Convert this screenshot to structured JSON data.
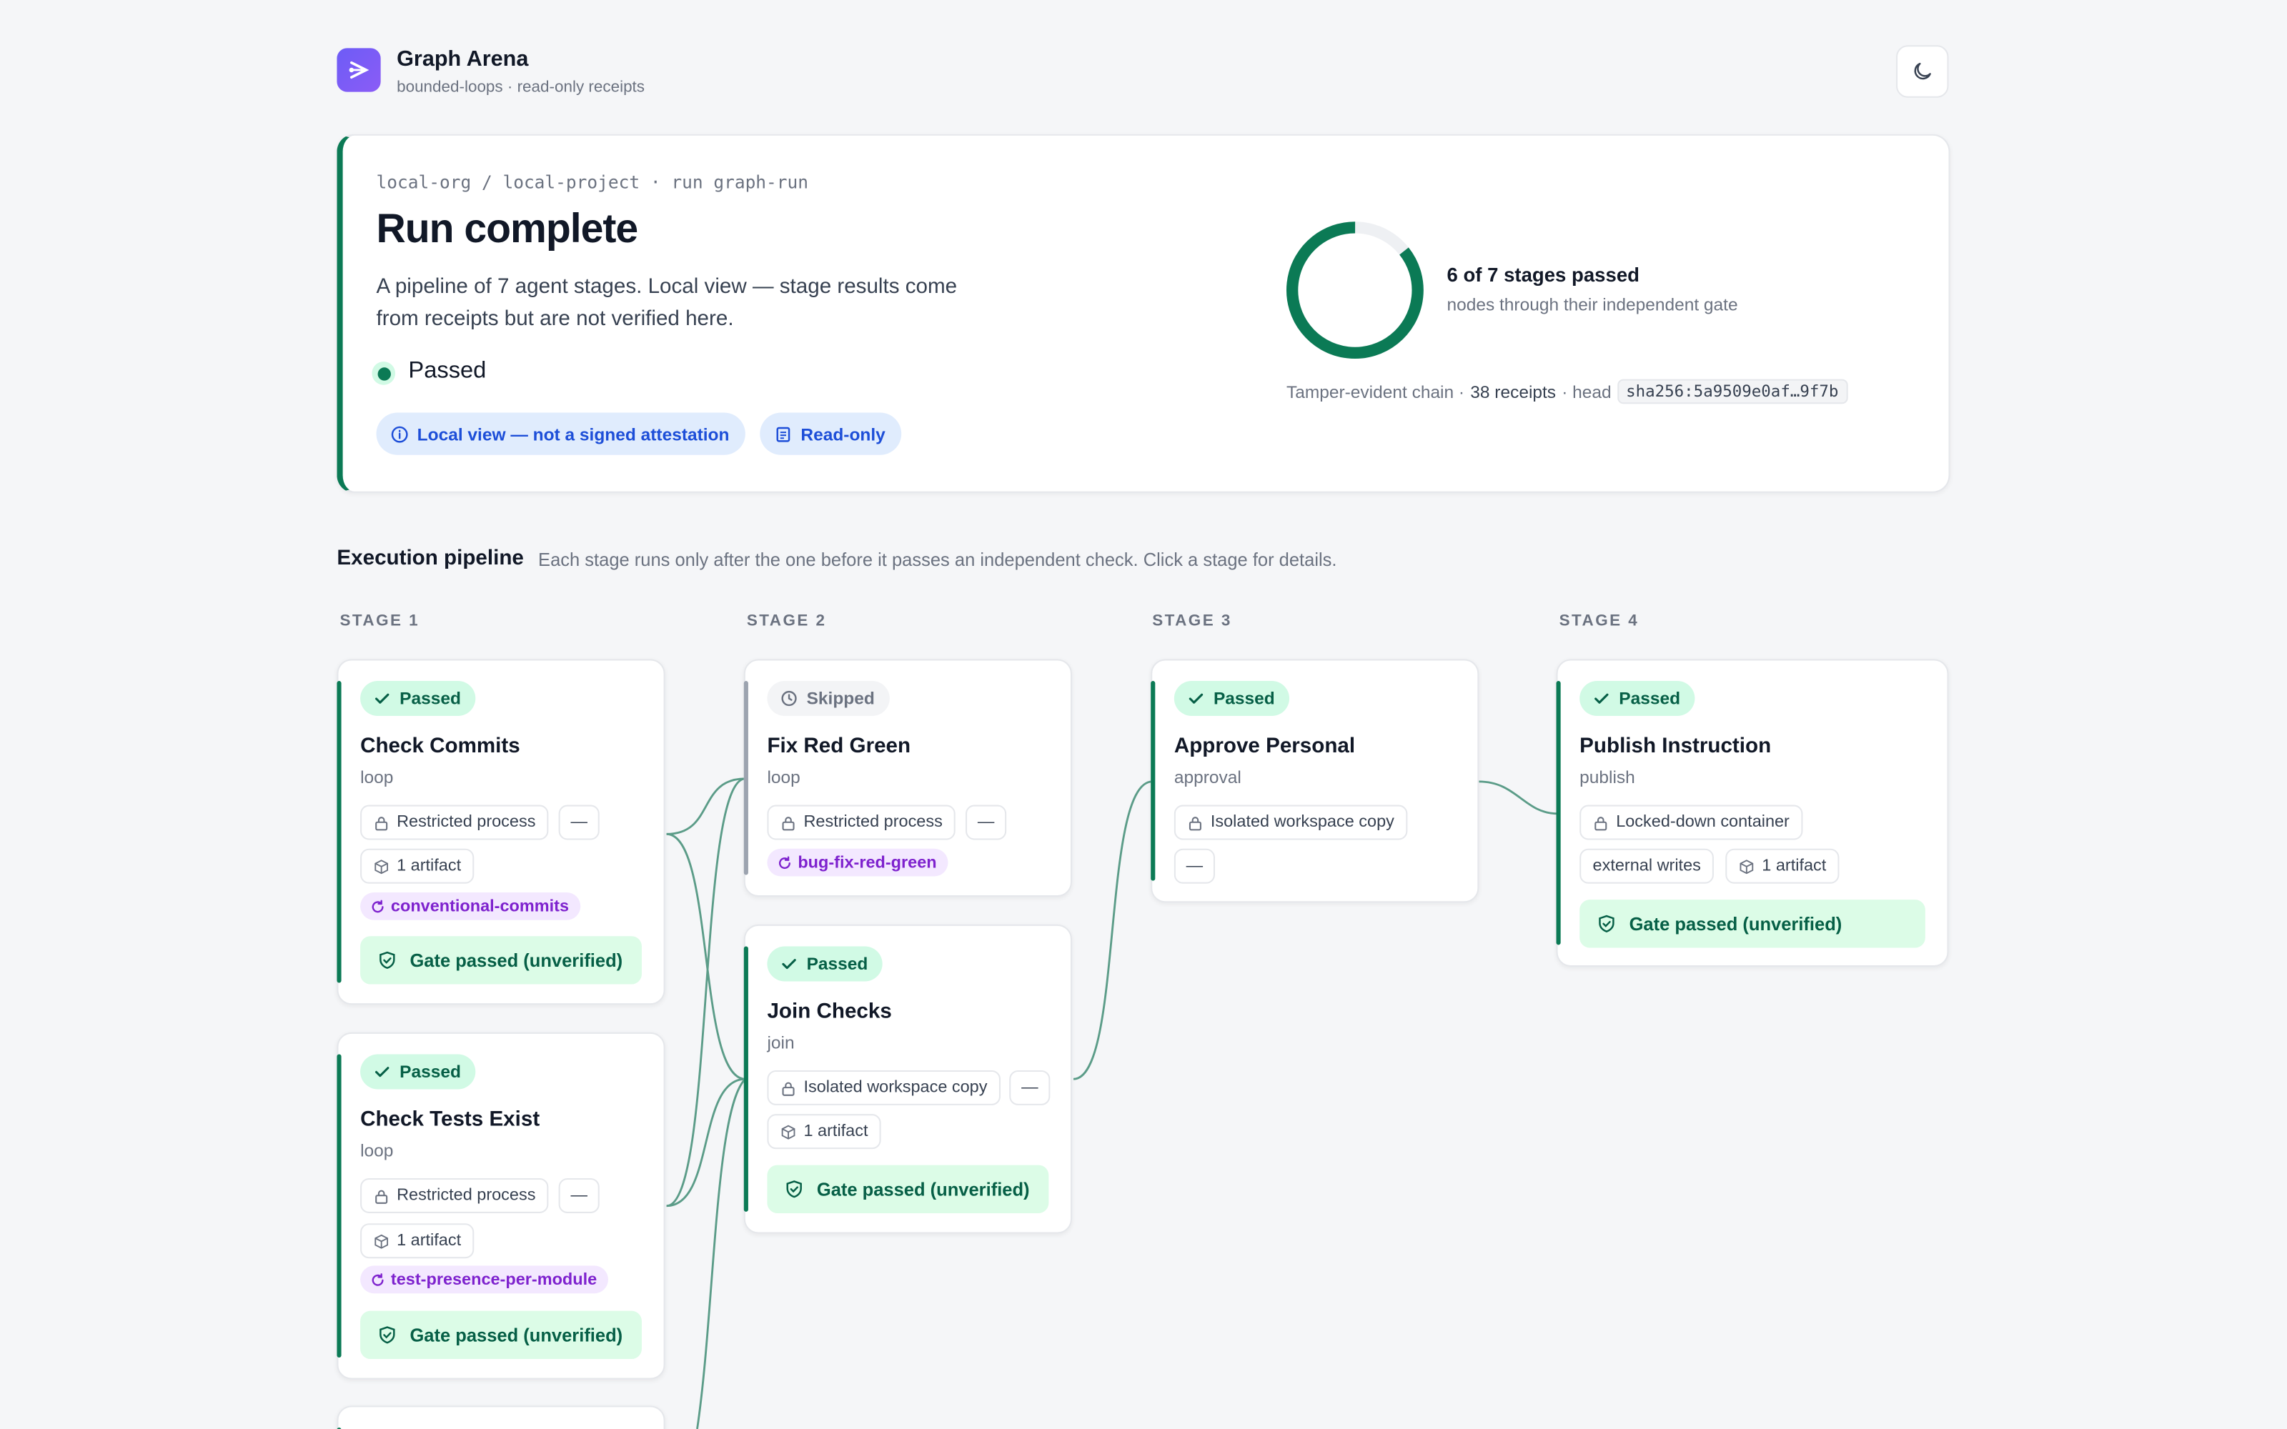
{
  "app": {
    "title": "Graph Arena",
    "subtitle": "bounded-loops · read-only receipts",
    "theme_icon": "moon-icon"
  },
  "summary": {
    "breadcrumb": "local-org / local-project · run graph-run",
    "title": "Run complete",
    "description": "A pipeline of 7 agent stages. Local view — stage results come from receipts but are not verified here.",
    "status": "Passed",
    "pills": [
      "Local view — not a signed attestation",
      "Read-only"
    ],
    "progress": {
      "passed": 6,
      "total": 7,
      "label": "6 of 7 stages passed",
      "sublabel": "nodes through their independent gate"
    },
    "chain": {
      "prefix": "Tamper-evident chain ·",
      "receipts": "38 receipts",
      "sep": "· head",
      "hash": "sha256:5a9509e0af…9f7b"
    }
  },
  "pipeline": {
    "title": "Execution pipeline",
    "description": "Each stage runs only after the one before it passes an independent check. Click a stage for details.",
    "stages": [
      "STAGE 1",
      "STAGE 2",
      "STAGE 3",
      "STAGE 4"
    ],
    "nodes": [
      {
        "status": "Passed",
        "title": "Check Commits",
        "kind": "loop",
        "sandbox": "Restricted process",
        "extra": "—",
        "artifacts": "1 artifact",
        "tag": "conventional-commits",
        "gate": "Gate passed (unverified)"
      },
      {
        "status": "Passed",
        "title": "Check Tests Exist",
        "kind": "loop",
        "sandbox": "Restricted process",
        "extra": "—",
        "artifacts": "1 artifact",
        "tag": "test-presence-per-module",
        "gate": "Gate passed (unverified)"
      },
      {
        "status": "Skipped",
        "title": "Fix Red Green",
        "kind": "loop",
        "sandbox": "Restricted process",
        "extra": "—",
        "tag": "bug-fix-red-green"
      },
      {
        "status": "Passed",
        "title": "Join Checks",
        "kind": "join",
        "sandbox": "Isolated workspace copy",
        "extra": "—",
        "artifacts": "1 artifact",
        "gate": "Gate passed (unverified)"
      },
      {
        "status": "Passed",
        "title": "Approve Personal",
        "kind": "approval",
        "sandbox": "Isolated workspace copy",
        "extra": "—"
      },
      {
        "status": "Passed",
        "title": "Publish Instruction",
        "kind": "publish",
        "sandbox": "Locked-down container",
        "writes": "external writes",
        "artifacts": "1 artifact",
        "gate": "Gate passed (unverified)"
      }
    ]
  },
  "colors": {
    "accent": "#0b7a55",
    "brand": "#7c5cf6",
    "info": "#1d4ed8",
    "tag": "#7e22ce"
  }
}
